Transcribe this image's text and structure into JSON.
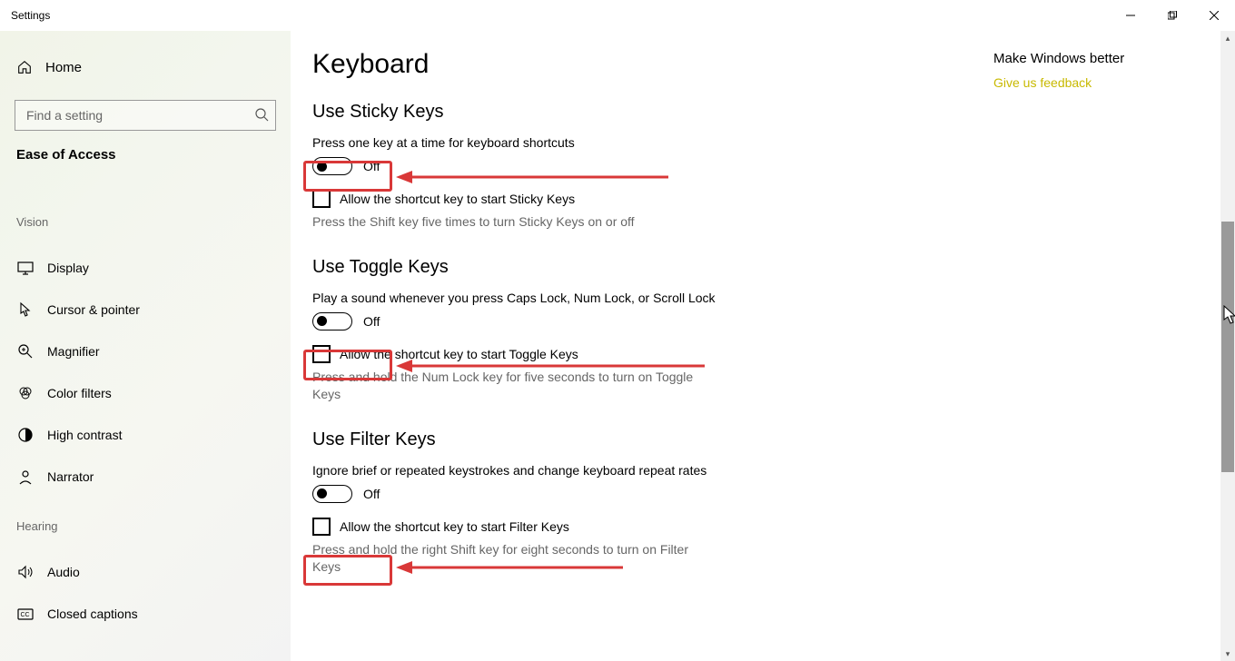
{
  "window": {
    "title": "Settings"
  },
  "sidebar": {
    "home": "Home",
    "search_placeholder": "Find a setting",
    "section": "Ease of Access",
    "groups": [
      {
        "label": "Vision",
        "items": [
          {
            "icon": "display",
            "label": "Display"
          },
          {
            "icon": "cursor",
            "label": "Cursor & pointer"
          },
          {
            "icon": "magnifier",
            "label": "Magnifier"
          },
          {
            "icon": "colorfilters",
            "label": "Color filters"
          },
          {
            "icon": "highcontrast",
            "label": "High contrast"
          },
          {
            "icon": "narrator",
            "label": "Narrator"
          }
        ]
      },
      {
        "label": "Hearing",
        "items": [
          {
            "icon": "audio",
            "label": "Audio"
          },
          {
            "icon": "cc",
            "label": "Closed captions"
          }
        ]
      }
    ]
  },
  "page": {
    "title": "Keyboard",
    "sections": [
      {
        "heading": "Use Sticky Keys",
        "desc": "Press one key at a time for keyboard shortcuts",
        "toggle": "Off",
        "checkbox": "Allow the shortcut key to start Sticky Keys",
        "helper": "Press the Shift key five times to turn Sticky Keys on or off"
      },
      {
        "heading": "Use Toggle Keys",
        "desc": "Play a sound whenever you press Caps Lock, Num Lock, or Scroll Lock",
        "toggle": "Off",
        "checkbox": "Allow the shortcut key to start Toggle Keys",
        "helper": "Press and hold the Num Lock key for five seconds to turn on Toggle Keys"
      },
      {
        "heading": "Use Filter Keys",
        "desc": "Ignore brief or repeated keystrokes and change keyboard repeat rates",
        "toggle": "Off",
        "checkbox": "Allow the shortcut key to start Filter Keys",
        "helper": "Press and hold the right Shift key for eight seconds to turn on Filter Keys"
      }
    ]
  },
  "right": {
    "heading": "Make Windows better",
    "link": "Give us feedback"
  }
}
